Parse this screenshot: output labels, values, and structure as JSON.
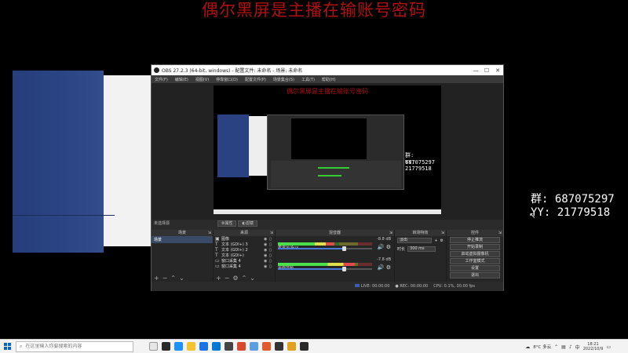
{
  "overlay": {
    "headline": "偶尔黑屏是主播在输账号密码",
    "qq_group": "群: 687075297",
    "yy": "YY: 21779518"
  },
  "window": {
    "title": "OBS 27.2.3 (64-bit, windows) - 配置文件: 未命名 - 场景: 未命名",
    "controls": [
      "—",
      "☐",
      "✕"
    ]
  },
  "menu": [
    "文件(F)",
    "编辑(E)",
    "视图(V)",
    "停靠窗口(D)",
    "配置文件(P)",
    "场景集合(S)",
    "工具(T)",
    "帮助(H)"
  ],
  "preview": {
    "headline": "偶尔黑屏是主播在输账号密码",
    "qq_group": "群: 687075297",
    "yy": "YY: 21779518"
  },
  "scene_bar": {
    "label": "未选择源",
    "properties_btn": "⚙属性",
    "filters_btn": "◐滤镜"
  },
  "docks": {
    "scenes": {
      "title": "场景",
      "items": [
        "场景"
      ]
    },
    "sources": {
      "title": "来源",
      "items": [
        {
          "icon": "image",
          "name": "图像"
        },
        {
          "icon": "text",
          "name": "文本 (GDI+) 3"
        },
        {
          "icon": "text",
          "name": "文本 (GDI+) 2"
        },
        {
          "icon": "text",
          "name": "文本 (GDI+)"
        },
        {
          "icon": "window",
          "name": "窗口采集 4"
        },
        {
          "icon": "window",
          "name": "窗口采集 4"
        }
      ]
    },
    "mixer": {
      "title": "混音器",
      "channels": [
        {
          "name": "麦克风/Aux",
          "db": "-8.8 dB",
          "level": 0.6,
          "volume": 0.7
        },
        {
          "name": "桌面音频",
          "db": "-7.8 dB",
          "level": 0.82,
          "volume": 0.7
        }
      ]
    },
    "transitions": {
      "title": "转场特效",
      "selected": "淡出",
      "duration_label": "时长",
      "duration": "300 ms"
    },
    "controls": {
      "title": "控件",
      "buttons": [
        "停止推流",
        "开始录制",
        "启动虚拟摄像机",
        "工作室模式",
        "设置",
        "退出"
      ]
    }
  },
  "status": {
    "live": "LIVE: 00:00:00",
    "rec": "REC: 00:00:00",
    "cpu": "CPU: 0.1%, 30.00 fps"
  },
  "taskbar": {
    "search_placeholder": "在这里输入你要搜索的内容",
    "weather": "8°C 多云",
    "time": "18:21",
    "date": "2022/10/9"
  }
}
